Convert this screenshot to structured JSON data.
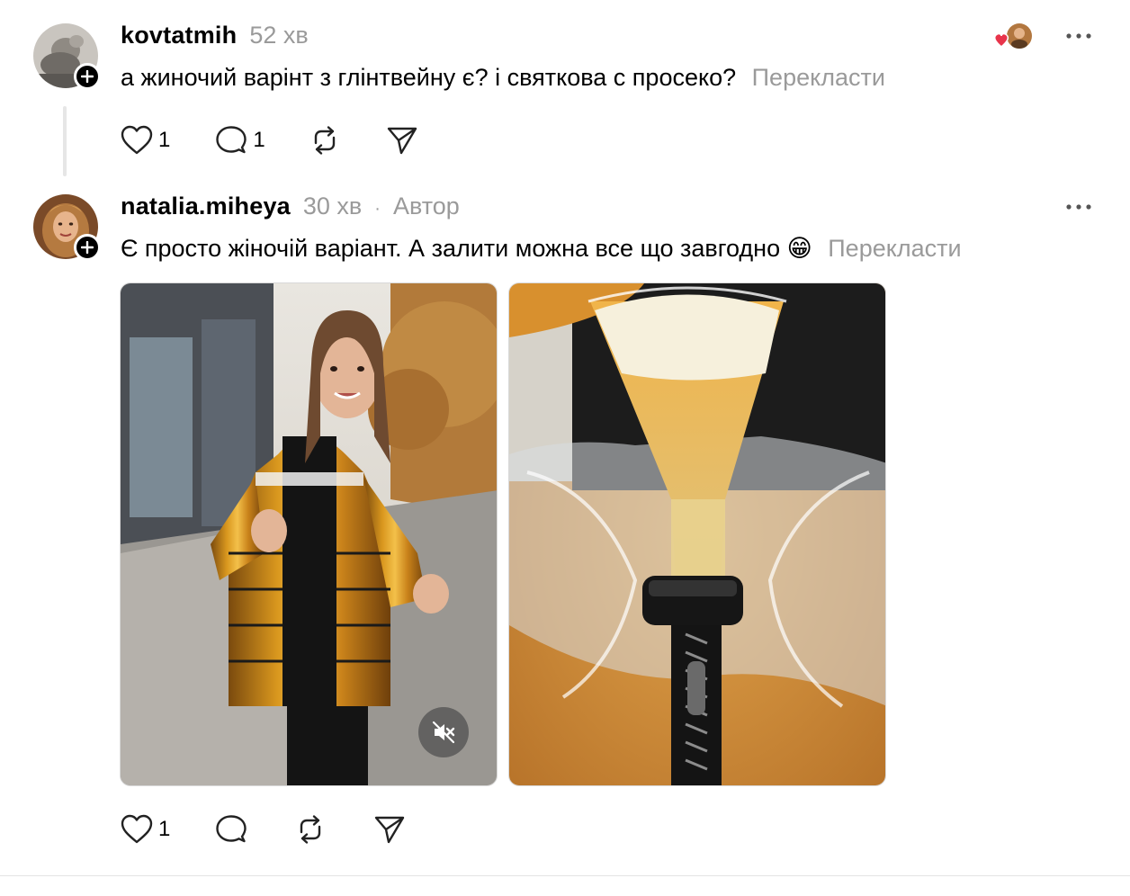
{
  "colors": {
    "text": "#000000",
    "muted": "#9a9a9a",
    "heart_red": "#e8344b",
    "divider": "#e4e4e4"
  },
  "post1": {
    "username": "kovtatmih",
    "time": "52 хв",
    "text": "а жиночий варінт з глінтвейну є? і святкова с просеко?",
    "translate": "Перекласти",
    "likes": "1",
    "replies": "1",
    "icons": [
      "heart-icon",
      "comment-icon",
      "repost-icon",
      "share-icon",
      "more-icon",
      "liked-by-avatar-icon"
    ]
  },
  "post2": {
    "username": "natalia.miheya",
    "time": "30 хв",
    "separator": "·",
    "author_badge": "Автор",
    "text": "Є просто жіночій варіант. А залити можна все що завгодно 😁",
    "translate": "Перекласти",
    "likes": "1",
    "icons": [
      "heart-icon",
      "comment-icon",
      "repost-icon",
      "share-icon",
      "more-icon",
      "mute-icon"
    ]
  }
}
